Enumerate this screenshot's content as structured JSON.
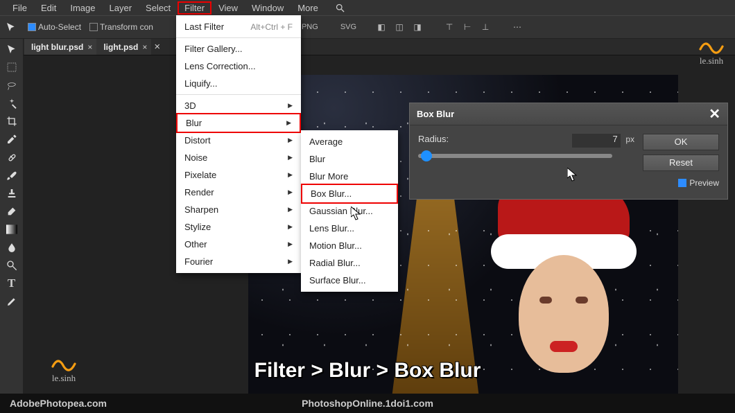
{
  "menubar": [
    "File",
    "Edit",
    "Image",
    "Layer",
    "Select",
    "Filter",
    "View",
    "Window",
    "More"
  ],
  "menubar_highlight_index": 5,
  "toolbar": {
    "auto_select": "Auto-Select",
    "transform": "Transform con",
    "exports": [
      "PNG",
      "SVG"
    ]
  },
  "tabs": [
    {
      "label": "light blur.psd",
      "active": true
    },
    {
      "label": "light.psd",
      "active": false
    }
  ],
  "filter_menu": {
    "last_filter": {
      "label": "Last Filter",
      "shortcut": "Alt+Ctrl + F"
    },
    "items1": [
      "Filter Gallery...",
      "Lens Correction...",
      "Liquify..."
    ],
    "submenus": [
      "3D",
      "Blur",
      "Distort",
      "Noise",
      "Pixelate",
      "Render",
      "Sharpen",
      "Stylize",
      "Other",
      "Fourier"
    ],
    "highlight_sub_index": 1
  },
  "blur_menu": {
    "items": [
      "Average",
      "Blur",
      "Blur More",
      "Box Blur...",
      "Gaussian Blur...",
      "Lens Blur...",
      "Motion Blur...",
      "Radial Blur...",
      "Surface Blur..."
    ],
    "highlight_index": 3
  },
  "dialog": {
    "title": "Box Blur",
    "radius_label": "Radius:",
    "radius_value": "7",
    "radius_unit": "px",
    "ok": "OK",
    "reset": "Reset",
    "preview": "Preview"
  },
  "watermark": "le.sinh",
  "caption": "Filter > Blur > Box Blur",
  "footer": {
    "left": "AdobePhotopea.com",
    "mid": "PhotoshopOnline.1doi1.com"
  }
}
